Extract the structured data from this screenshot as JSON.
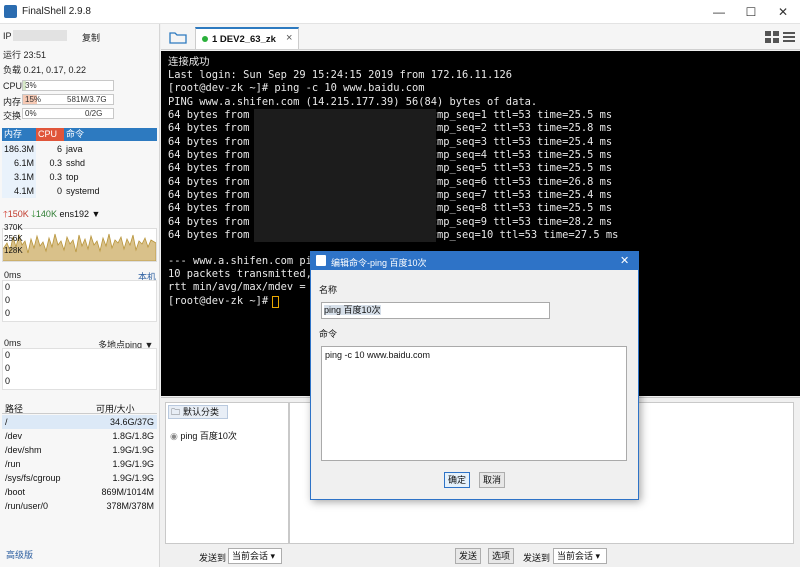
{
  "window": {
    "title": "FinalShell 2.9.8",
    "minimize": "—",
    "maximize": "☐",
    "close": "✕"
  },
  "sidebar": {
    "ip_label": "IP",
    "copy": "复制",
    "uptime": "运行 23:51",
    "load": "负载 0.21, 0.17, 0.22",
    "cpu_label": "CPU",
    "cpu_value": "3%",
    "cpu_pct": 3,
    "mem_label": "内存",
    "mem_value": "15%",
    "mem_detail": "581M/3.7G",
    "mem_pct": 15,
    "swap_label": "交换",
    "swap_value": "0%",
    "swap_detail": "0/2G",
    "swap_pct": 0,
    "proc_headers": [
      "内存",
      "CPU",
      "命令"
    ],
    "processes": [
      {
        "mem": "186.3M",
        "cpu": "6",
        "cmd": "java"
      },
      {
        "mem": "6.1M",
        "cpu": "0.3",
        "cmd": "sshd"
      },
      {
        "mem": "3.1M",
        "cpu": "0.3",
        "cmd": "top"
      },
      {
        "mem": "4.1M",
        "cpu": "0",
        "cmd": "systemd"
      }
    ],
    "net_up": "150K",
    "net_down": "140K",
    "net_iface": "ens192",
    "net_ticks": [
      "370K",
      "256K",
      "128K"
    ],
    "latency1": {
      "label": "0ms",
      "target": "本机",
      "ticks": [
        "0",
        "0",
        "0"
      ]
    },
    "latency2": {
      "label": "0ms",
      "target": "多地点ping",
      "ticks": [
        "0",
        "0",
        "0"
      ]
    },
    "disk_headers": [
      "路径",
      "可用/大小"
    ],
    "disks": [
      {
        "path": "/",
        "size": "34.6G/37G"
      },
      {
        "path": "/dev",
        "size": "1.8G/1.8G"
      },
      {
        "path": "/dev/shm",
        "size": "1.9G/1.9G"
      },
      {
        "path": "/run",
        "size": "1.9G/1.9G"
      },
      {
        "path": "/sys/fs/cgroup",
        "size": "1.9G/1.9G"
      },
      {
        "path": "/boot",
        "size": "869M/1014M"
      },
      {
        "path": "/run/user/0",
        "size": "378M/378M"
      }
    ],
    "advanced": "高级版"
  },
  "tab": {
    "label": "1 DEV2_63_zk",
    "close": "×"
  },
  "terminal": {
    "lines": [
      "连接成功",
      "Last login: Sun Sep 29 15:24:15 2019 from 172.16.11.126",
      "[root@dev-zk ~]# ping -c 10 www.baidu.com",
      "PING www.a.shifen.com (14.215.177.39) 56(84) bytes of data.",
      "64 bytes from                          : icmp_seq=1 ttl=53 time=25.5 ms",
      "64 bytes from                          : icmp_seq=2 ttl=53 time=25.8 ms",
      "64 bytes from                          : icmp_seq=3 ttl=53 time=25.4 ms",
      "64 bytes from                          : icmp_seq=4 ttl=53 time=25.5 ms",
      "64 bytes from                          : icmp_seq=5 ttl=53 time=25.5 ms",
      "64 bytes from                          : icmp_seq=6 ttl=53 time=26.8 ms",
      "64 bytes from                          : icmp_seq=7 ttl=53 time=25.4 ms",
      "64 bytes from                          : icmp_seq=8 ttl=53 time=25.5 ms",
      "64 bytes from                          : icmp_seq=9 ttl=53 time=28.2 ms",
      "64 bytes from                          : icmp_seq=10 ttl=53 time=27.5 ms",
      "",
      "--- www.a.shifen.com pi",
      "10 packets transmitted,",
      "rtt min/avg/max/mdev =",
      "[root@dev-zk ~]# "
    ]
  },
  "bottom": {
    "category": "默认分类",
    "command_item": "ping 百度10次",
    "send_to": "发送到",
    "current_session": "当前会话",
    "send": "发送",
    "options": "选项"
  },
  "dialog": {
    "title": "编辑命令-ping 百度10次",
    "name_label": "名称",
    "name_value": "ping 百度10次",
    "cmd_label": "命令",
    "cmd_value": "ping -c 10 www.baidu.com",
    "ok": "确定",
    "cancel": "取消"
  },
  "colors": {
    "accent": "#2d7ac0",
    "mem_fill": "#f6c9b4",
    "cpu_fill": "#d7e9c9",
    "prompt_cursor": "#e8a800"
  }
}
